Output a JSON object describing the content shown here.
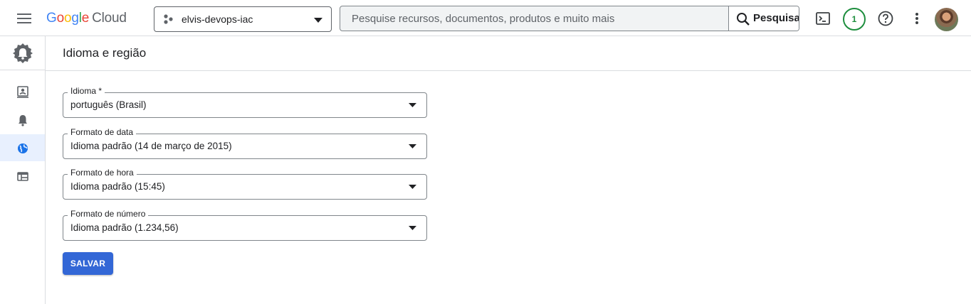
{
  "header": {
    "logo_letters": [
      "G",
      "o",
      "o",
      "g",
      "l",
      "e"
    ],
    "logo_product": "Cloud",
    "project": "elvis-devops-iac",
    "search_placeholder": "Pesquise recursos, documentos, produtos e muito mais",
    "search_button": "Pesquisa",
    "notifications_count": "1"
  },
  "page": {
    "title": "Idioma e região"
  },
  "form": {
    "fields": [
      {
        "label": "Idioma *",
        "value": "português (Brasil)"
      },
      {
        "label": "Formato de data",
        "value": "Idioma padrão (14 de março de 2015)"
      },
      {
        "label": "Formato de hora",
        "value": "Idioma padrão (15:45)"
      },
      {
        "label": "Formato de número",
        "value": "Idioma padrão (1.234,56)"
      }
    ],
    "save_label": "SALVAR"
  },
  "colors": {
    "accent": "#3367d6",
    "active_nav": "#1a73e8",
    "badge": "#1e8e3e"
  },
  "icons": {
    "menu": "hamburger-menu-icon",
    "project": "project-hierarchy-icon",
    "search": "search-icon",
    "terminal": "cloud-shell-icon",
    "help": "help-icon",
    "more": "more-vert-icon",
    "settings": "gear-bell-icon",
    "nav": [
      "account-icon",
      "notifications-bell-icon",
      "globe-icon",
      "web-table-icon"
    ]
  }
}
